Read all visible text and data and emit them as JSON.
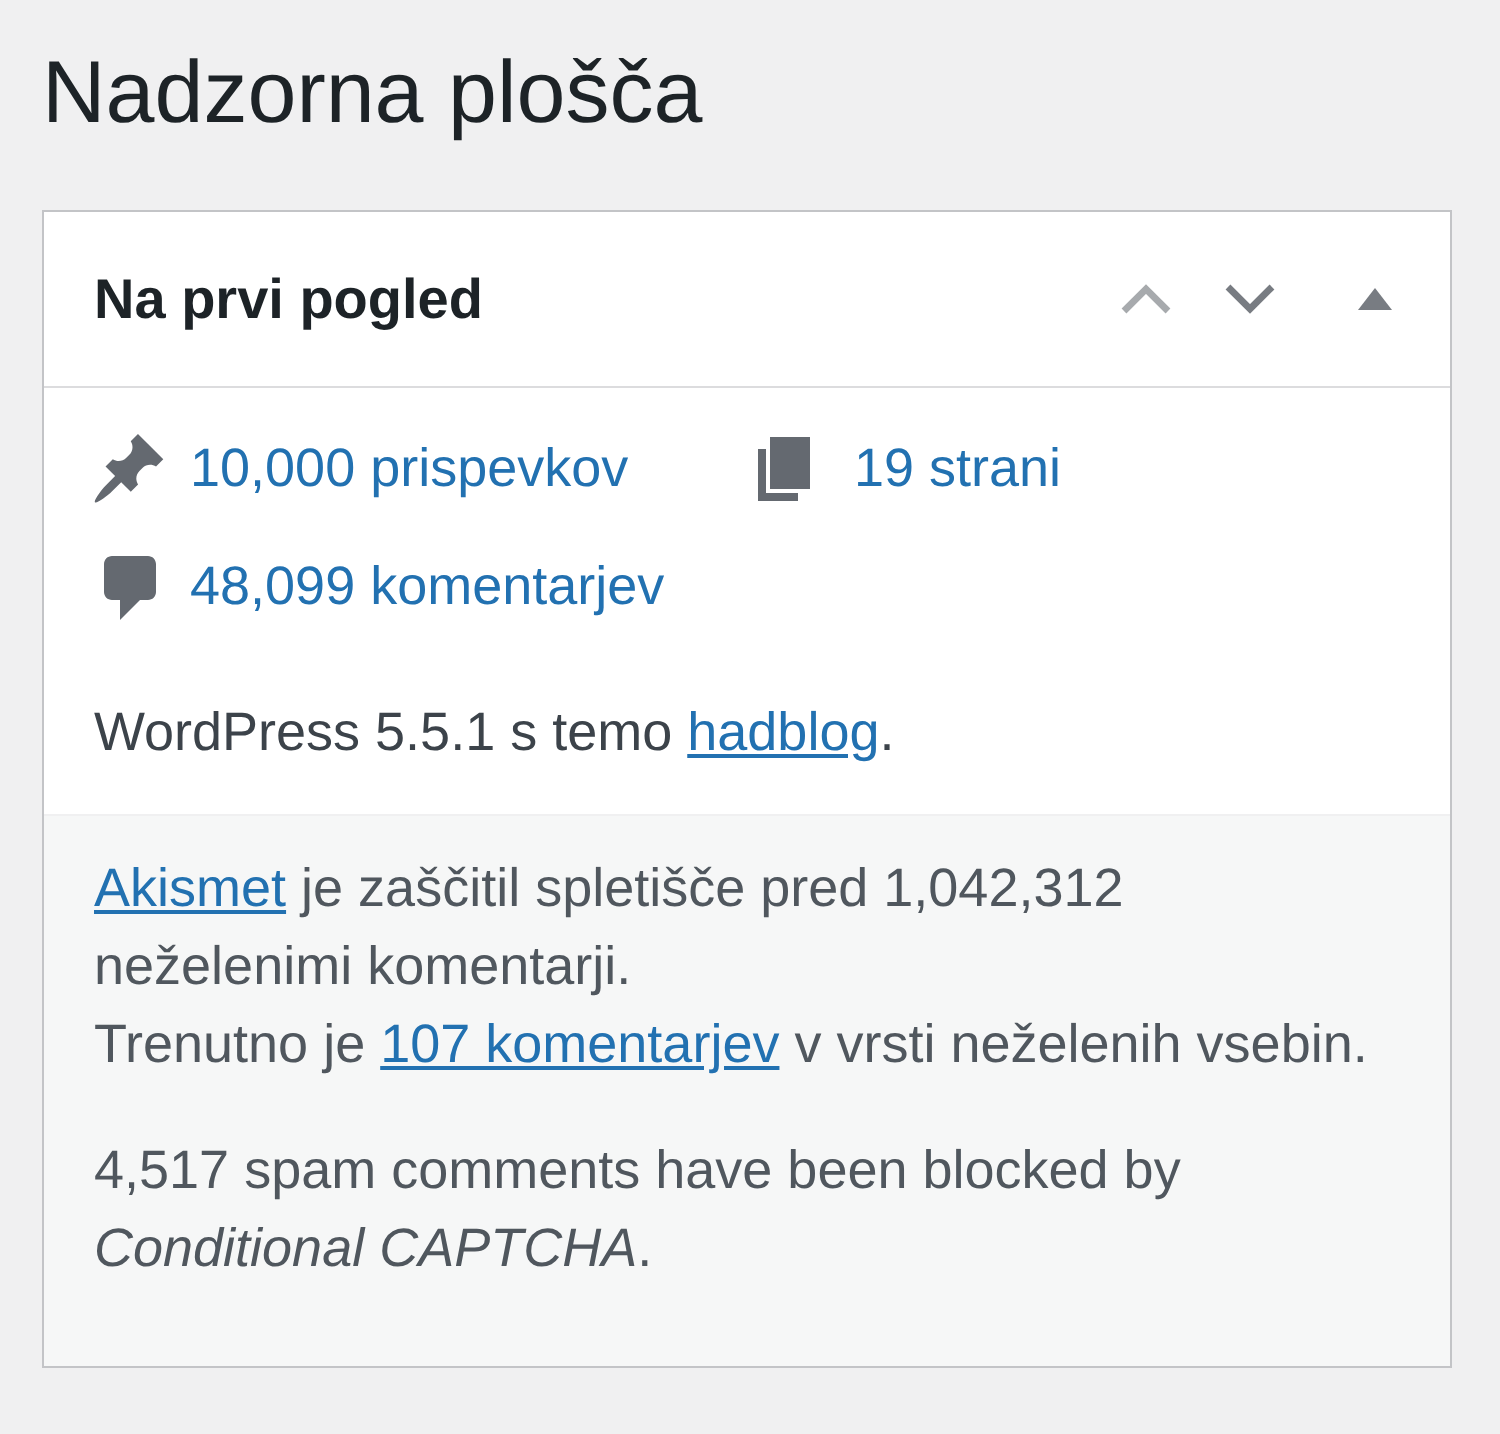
{
  "page": {
    "title": "Nadzorna plošča"
  },
  "widget": {
    "title": "Na prvi pogled",
    "controls": [
      {
        "kind": "move_up",
        "disabled": true
      },
      {
        "kind": "move_down",
        "disabled": false
      },
      {
        "kind": "toggle",
        "expanded": true
      }
    ],
    "stats": [
      {
        "kind": "posts",
        "label": "10,000 prispevkov"
      },
      {
        "kind": "pages",
        "label": "19 strani"
      },
      {
        "kind": "comments",
        "label": "48,099 komentarjev"
      }
    ],
    "version": [
      {
        "kind": "text",
        "text": "WordPress 5.5.1 s temo "
      },
      {
        "kind": "link",
        "text": "hadblog"
      },
      {
        "kind": "text",
        "text": "."
      }
    ],
    "footer": {
      "paragraphs": [
        {
          "sentences": [
            [
              {
                "kind": "link",
                "text": "Akismet"
              },
              {
                "kind": "text",
                "text": " je zaščitil spletišče pred 1,042,312 neželenimi komentarji."
              }
            ],
            [
              {
                "kind": "text",
                "text": "Trenutno je "
              },
              {
                "kind": "link",
                "text": "107 komentarjev"
              },
              {
                "kind": "text",
                "text": " v vrsti neželenih vsebin."
              }
            ]
          ]
        },
        {
          "sentences": [
            [
              {
                "kind": "text",
                "text": "4,517 spam comments have been blocked by *Conditional CAPTCHA*."
              }
            ]
          ]
        }
      ]
    }
  }
}
